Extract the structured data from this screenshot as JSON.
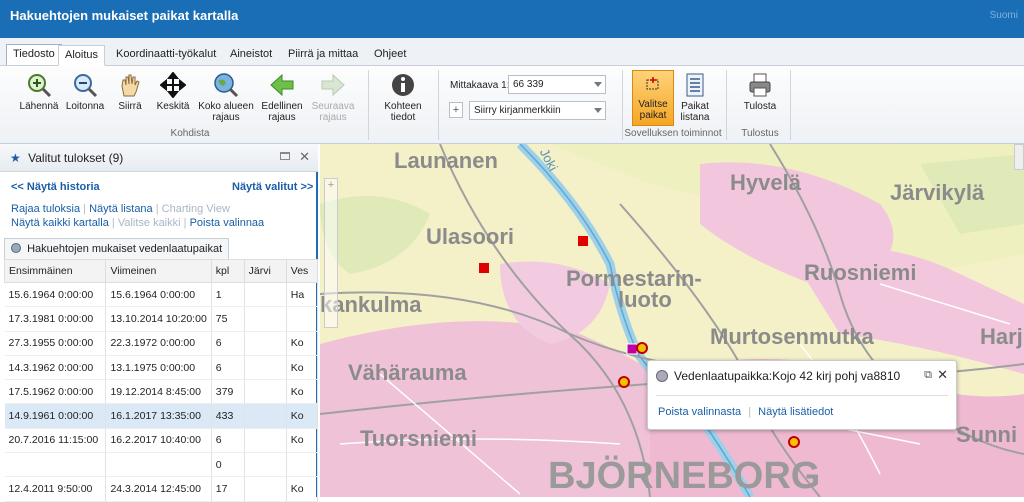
{
  "app": {
    "title": "Hakuehtojen mukaiset paikat kartalla",
    "corner": "Suomi"
  },
  "tabs": [
    "Tiedosto",
    "Aloitus",
    "Koordinaatti-työkalut",
    "Aineistot",
    "Piirrä ja mittaa",
    "Ohjeet"
  ],
  "ribbon": {
    "zoom_in": "Lähennä",
    "zoom_out": "Loitonna",
    "pan": "Siirrä",
    "center": "Keskitä",
    "full_extent": "Koko alueen rajaus",
    "previous": "Edellinen rajaus",
    "next": "Seuraava rajaus",
    "group_kohdista": "Kohdista",
    "item_info": "Kohteen tiedot",
    "scale_label": "Mittakaava 1:",
    "scale_value": "66 339",
    "bookmark_plus": "+",
    "bookmark_select": "Siirry kirjanmerkkiin",
    "select_places": "Valitse paikat",
    "places_list": "Paikat listana",
    "group_app": "Sovelluksen toiminnot",
    "print": "Tulosta",
    "group_print": "Tulostus"
  },
  "panel": {
    "title": "Valitut tulokset (9)",
    "show_history": "<< Näytä historia",
    "show_selected": "Näytä valitut >>",
    "filter_results": "Rajaa tuloksia",
    "show_list": "Näytä listana",
    "charting": "Charting View",
    "show_all_map": "Näytä kaikki kartalla",
    "select_all": "Valitse kaikki",
    "clear_selection": "Poista valinnaa",
    "table_tab": "Hakuehtojen mukaiset vedenlaatupaikat",
    "columns": [
      "Ensimmäinen",
      "Viimeinen",
      "kpl",
      "Järvi",
      "Ves"
    ],
    "rows": [
      [
        "15.6.1964 0:00:00",
        "15.6.1964 0:00:00",
        "1",
        "",
        "Ha"
      ],
      [
        "17.3.1981 0:00:00",
        "13.10.2014 10:20:00",
        "75",
        "",
        ""
      ],
      [
        "27.3.1955 0:00:00",
        "22.3.1972 0:00:00",
        "6",
        "",
        "Ko"
      ],
      [
        "14.3.1962 0:00:00",
        "13.1.1975 0:00:00",
        "6",
        "",
        "Ko"
      ],
      [
        "17.5.1962 0:00:00",
        "19.12.2014 8:45:00",
        "379",
        "",
        "Ko"
      ],
      [
        "14.9.1961 0:00:00",
        "16.1.2017 13:35:00",
        "433",
        "",
        "Ko"
      ],
      [
        "20.7.2016 11:15:00",
        "16.2.2017 10:40:00",
        "6",
        "",
        "Ko"
      ],
      [
        "",
        "",
        "0",
        "",
        ""
      ],
      [
        "12.4.2011 9:50:00",
        "24.3.2014 12:45:00",
        "17",
        "",
        "Ko"
      ]
    ]
  },
  "map": {
    "labels": [
      "Launanen",
      "Hyvelä",
      "Järvikylä",
      "Ulasoori",
      "Pormestarin-",
      "luoto",
      "Ruosniemi",
      "kankulma",
      "Murtosenmutka",
      "Harj",
      "Vähärauma",
      "Tuorsniemi",
      "Sunni",
      "BJÖRNEBORG",
      "Joki"
    ]
  },
  "popup": {
    "title": "Vedenlaatupaikka:Kojo 42 kirj pohj va8810",
    "clear": "Poista valinnasta",
    "details": "Näytä lisätiedot",
    "sep": "|"
  }
}
